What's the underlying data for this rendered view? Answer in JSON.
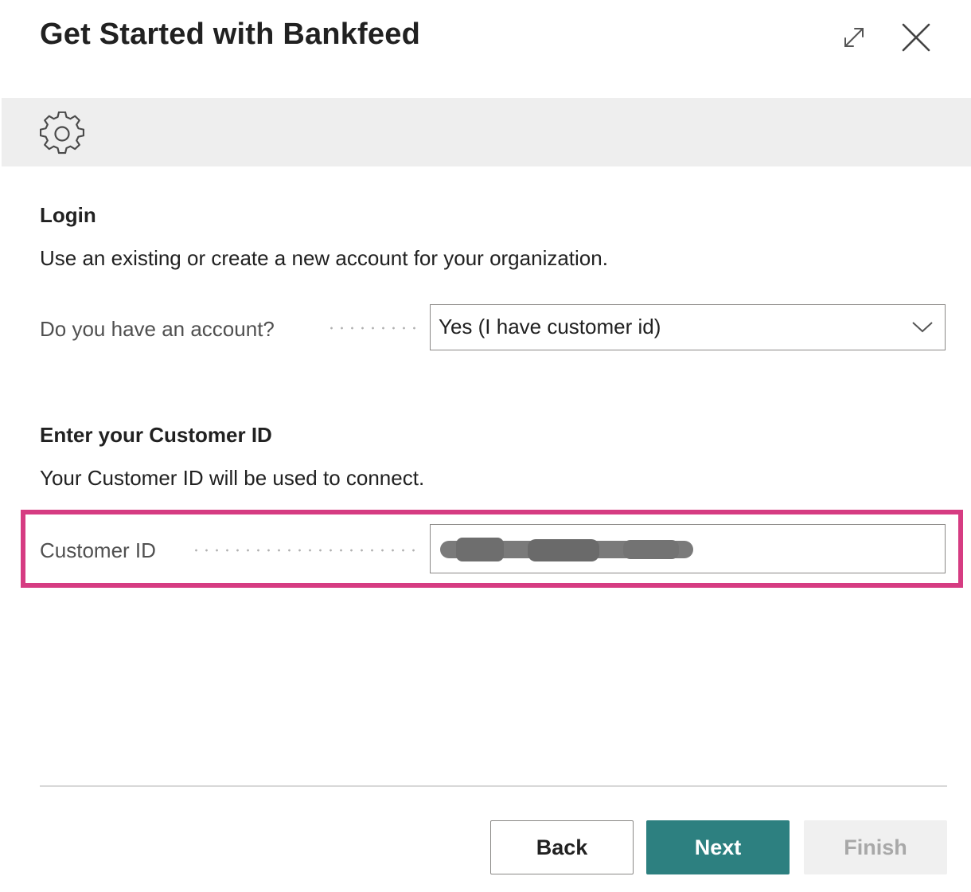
{
  "dialog": {
    "title": "Get Started with Bankfeed"
  },
  "icons": {
    "expand": "expand-icon",
    "close": "close-icon",
    "settings": "gear-icon",
    "dropdown": "chevron-down-icon"
  },
  "login": {
    "heading": "Login",
    "description": "Use an existing or create a new account for your organization.",
    "account_label": "Do you have an account?",
    "account_value": "Yes (I have customer id)"
  },
  "customer": {
    "heading": "Enter your Customer ID",
    "description": "Your Customer ID will be used to connect.",
    "id_label": "Customer ID"
  },
  "buttons": {
    "back": "Back",
    "next": "Next",
    "finish": "Finish"
  },
  "colors": {
    "accent": "#2d8080",
    "highlight_border": "#d63c82",
    "action_bar": "#eeeeee"
  }
}
